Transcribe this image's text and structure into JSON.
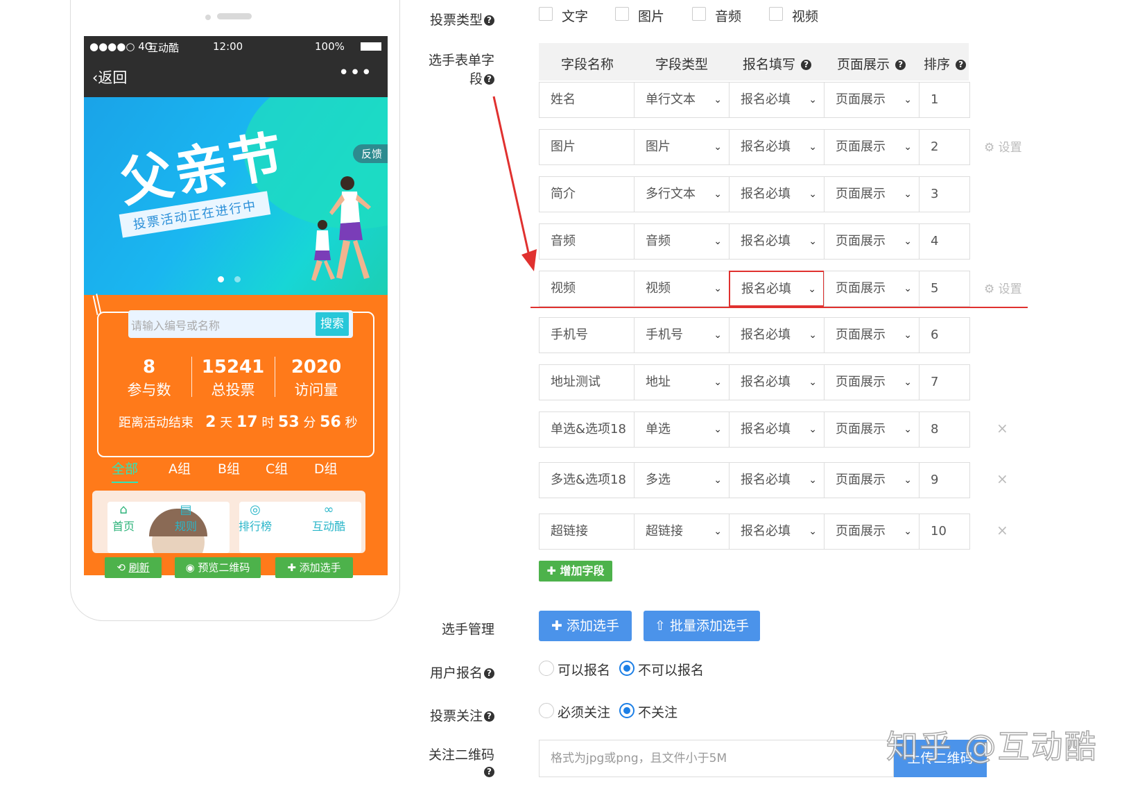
{
  "phone": {
    "status": {
      "signal": "●●●●○ 4G",
      "carrier": "互动酷",
      "time": "12:00",
      "battery": "100%"
    },
    "nav": {
      "back": "返回",
      "more": "•••"
    },
    "banner": {
      "title": "父亲节",
      "subtitle": "投票活动正在进行中",
      "feedback": "反馈"
    },
    "search": {
      "placeholder": "请输入编号或名称",
      "button": "搜索"
    },
    "stats": [
      {
        "num": "8",
        "label": "参与数"
      },
      {
        "num": "15241",
        "label": "总投票"
      },
      {
        "num": "2020",
        "label": "访问量"
      }
    ],
    "countdown": {
      "prefix": "距离活动结束",
      "days": "2",
      "days_unit": "天",
      "hours": "17",
      "hours_unit": "时",
      "minutes": "53",
      "minutes_unit": "分",
      "seconds": "56",
      "seconds_unit": "秒"
    },
    "groups": [
      "全部",
      "A组",
      "B组",
      "C组",
      "D组"
    ],
    "tabs": [
      "首页",
      "规则",
      "排行榜",
      "互动酷"
    ],
    "buttons": {
      "refresh": "刷新",
      "preview": "预览二维码",
      "add": "添加选手"
    }
  },
  "form": {
    "vote_type": {
      "label": "投票类型",
      "options": [
        "文字",
        "图片",
        "音频",
        "视频"
      ]
    },
    "fields": {
      "label_line1": "选手表单字",
      "label_line2": "段",
      "headers": [
        "字段名称",
        "字段类型",
        "报名填写",
        "页面展示",
        "排序"
      ],
      "rows": [
        {
          "name": "姓名",
          "type": "单行文本",
          "fill": "报名必填",
          "show": "页面展示",
          "order": "1",
          "action": ""
        },
        {
          "name": "图片",
          "type": "图片",
          "fill": "报名必填",
          "show": "页面展示",
          "order": "2",
          "action": "设置"
        },
        {
          "name": "简介",
          "type": "多行文本",
          "fill": "报名必填",
          "show": "页面展示",
          "order": "3",
          "action": ""
        },
        {
          "name": "音频",
          "type": "音频",
          "fill": "报名必填",
          "show": "页面展示",
          "order": "4",
          "action": ""
        },
        {
          "name": "视频",
          "type": "视频",
          "fill": "报名必填",
          "show": "页面展示",
          "order": "5",
          "action": "设置"
        },
        {
          "name": "手机号",
          "type": "手机号",
          "fill": "报名必填",
          "show": "页面展示",
          "order": "6",
          "action": ""
        },
        {
          "name": "地址测试",
          "type": "地址",
          "fill": "报名必填",
          "show": "页面展示",
          "order": "7",
          "action": ""
        },
        {
          "name": "单选&选项18",
          "type": "单选",
          "fill": "报名必填",
          "show": "页面展示",
          "order": "8",
          "action": "×"
        },
        {
          "name": "多选&选项18",
          "type": "多选",
          "fill": "报名必填",
          "show": "页面展示",
          "order": "9",
          "action": "×"
        },
        {
          "name": "超链接",
          "type": "超链接",
          "fill": "报名必填",
          "show": "页面展示",
          "order": "10",
          "action": "×"
        }
      ],
      "add_button": "增加字段"
    },
    "player_mgmt": {
      "label": "选手管理",
      "add": "添加选手",
      "batch": "批量添加选手"
    },
    "user_signup": {
      "label": "用户报名",
      "options": [
        "可以报名",
        "不可以报名"
      ],
      "selected": "不可以报名"
    },
    "vote_follow": {
      "label": "投票关注",
      "options": [
        "必须关注",
        "不关注"
      ],
      "selected": "不关注"
    },
    "qr": {
      "label": "关注二维码",
      "placeholder": "格式为jpg或png，且文件小于5M",
      "button": "上传二维码"
    }
  },
  "watermark": "知乎 @互动酷",
  "colors": {
    "orange": "#ff7a1a",
    "green": "#4db24b",
    "blue": "#4b93ea",
    "red": "#e0312f",
    "teal": "#27c7d9"
  }
}
